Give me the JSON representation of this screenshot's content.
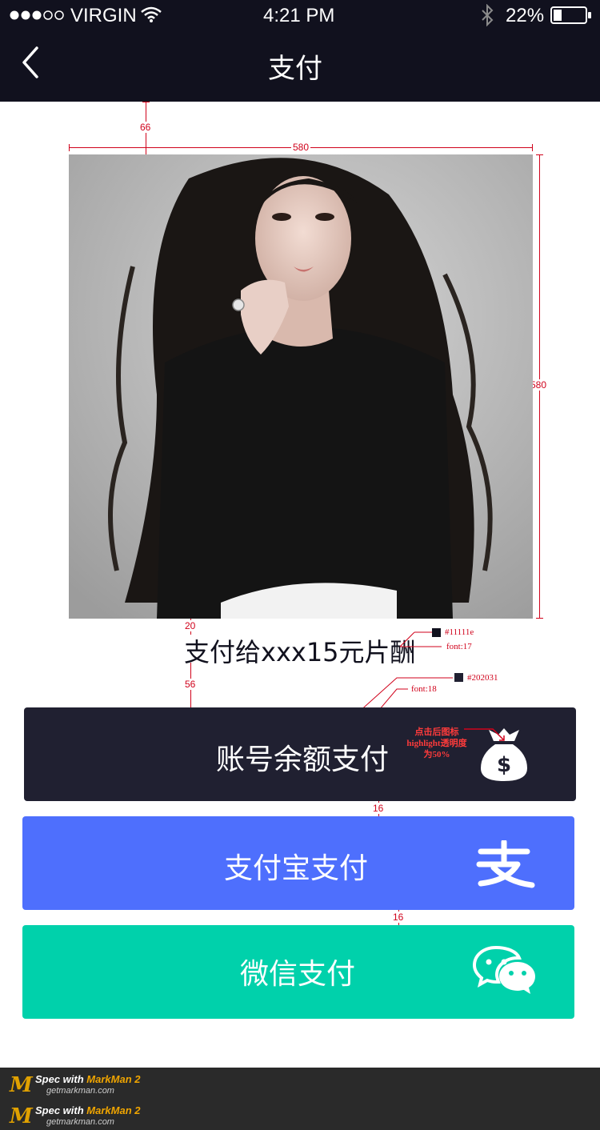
{
  "status_bar": {
    "carrier": "VIRGIN",
    "time": "4:21 PM",
    "battery": "22%"
  },
  "nav": {
    "title": "支付",
    "back_icon": "chevron-left-icon"
  },
  "photo": {
    "alt_subject": "portrait"
  },
  "payment_text": "支付给xxx15元片酬",
  "buttons": {
    "balance": {
      "label": "账号余额支付",
      "icon": "money-bag-icon",
      "color": "#202031"
    },
    "alipay": {
      "label": "支付宝支付",
      "icon": "alipay-icon",
      "color": "#4e6ffd"
    },
    "wechat": {
      "label": "微信支付",
      "icon": "wechat-icon",
      "color": "#00d1ab"
    }
  },
  "spec": {
    "m_top": "66",
    "m_width": "580",
    "m_height": "580",
    "m_gap_text": "20",
    "m_gap_btn": "56",
    "m_gap_1": "16",
    "m_gap_2": "16",
    "text_color": "#11111e",
    "text_font": "font:17",
    "btn_color": "#202031",
    "btn_font": "font:18",
    "note": [
      "点击后图标",
      "highlight透明度",
      "为50%"
    ]
  },
  "footer": {
    "brand_prefix": "Spec with ",
    "brand_name": "MarkMan 2",
    "domain": "getmarkman.com"
  }
}
